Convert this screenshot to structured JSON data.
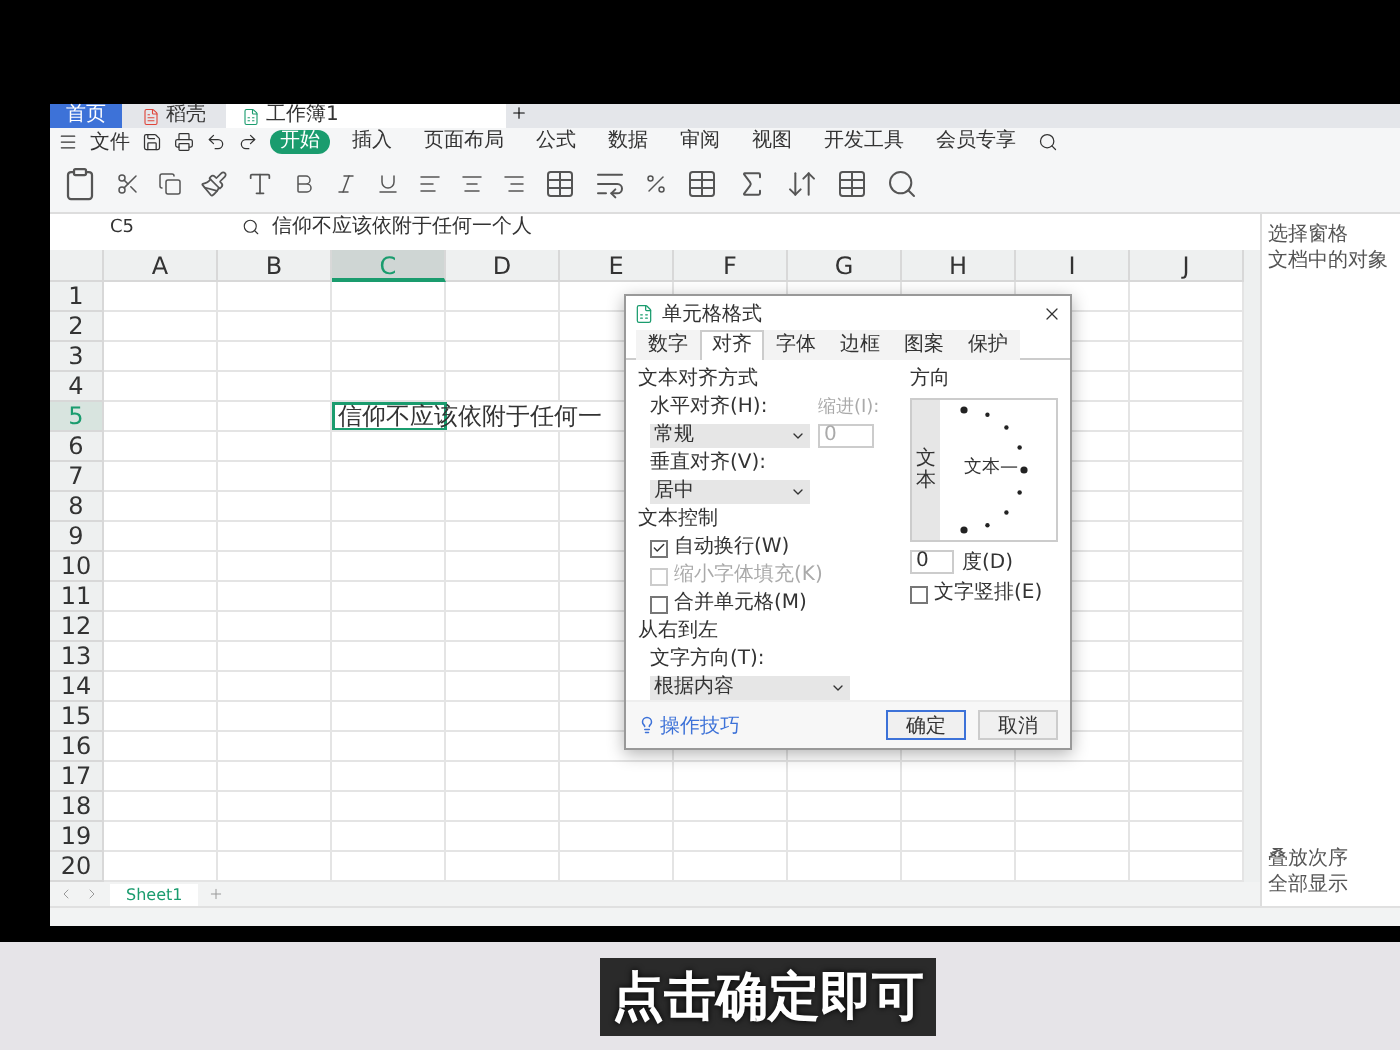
{
  "tabs": [
    {
      "label": "首页",
      "kind": "home",
      "selected": false
    },
    {
      "label": "稻壳",
      "kind": "docer",
      "selected": false
    },
    {
      "label": "工作簿1",
      "kind": "book",
      "selected": true
    }
  ],
  "menu": {
    "file": "文件",
    "items": [
      {
        "label": "开始",
        "selected": true
      },
      {
        "label": "插入",
        "selected": false
      },
      {
        "label": "页面布局",
        "selected": false
      },
      {
        "label": "公式",
        "selected": false
      },
      {
        "label": "数据",
        "selected": false
      },
      {
        "label": "审阅",
        "selected": false
      },
      {
        "label": "视图",
        "selected": false
      },
      {
        "label": "开发工具",
        "selected": false
      },
      {
        "label": "会员专享",
        "selected": false
      }
    ]
  },
  "formula_bar": {
    "name_box": "C5",
    "formula": "信仰不应该依附于任何一个人"
  },
  "sheet": {
    "columns": [
      {
        "label": "A",
        "selected": false
      },
      {
        "label": "B",
        "selected": false
      },
      {
        "label": "C",
        "selected": true
      },
      {
        "label": "D",
        "selected": false
      },
      {
        "label": "E",
        "selected": false
      },
      {
        "label": "F",
        "selected": false
      },
      {
        "label": "G",
        "selected": false
      },
      {
        "label": "H",
        "selected": false
      },
      {
        "label": "I",
        "selected": false
      },
      {
        "label": "J",
        "selected": false
      }
    ],
    "rows": [
      {
        "label": "1",
        "selected": false
      },
      {
        "label": "2",
        "selected": false
      },
      {
        "label": "3",
        "selected": false
      },
      {
        "label": "4",
        "selected": false
      },
      {
        "label": "5",
        "selected": true
      },
      {
        "label": "6",
        "selected": false
      },
      {
        "label": "7",
        "selected": false
      },
      {
        "label": "8",
        "selected": false
      },
      {
        "label": "9",
        "selected": false
      },
      {
        "label": "10",
        "selected": false
      },
      {
        "label": "11",
        "selected": false
      },
      {
        "label": "12",
        "selected": false
      },
      {
        "label": "13",
        "selected": false
      },
      {
        "label": "14",
        "selected": false
      },
      {
        "label": "15",
        "selected": false
      },
      {
        "label": "16",
        "selected": false
      },
      {
        "label": "17",
        "selected": false
      },
      {
        "label": "18",
        "selected": false
      },
      {
        "label": "19",
        "selected": false
      },
      {
        "label": "20",
        "selected": false
      }
    ],
    "active_cell_text": "信仰不应该依附于任何一"
  },
  "sheet_tabs": [
    {
      "label": "Sheet1",
      "selected": true
    }
  ],
  "side_pane": {
    "title": "选择窗格",
    "subtitle": "文档中的对象",
    "footer": [
      "叠放次序",
      "全部显示"
    ]
  },
  "dialog": {
    "title": "单元格格式",
    "tabs": [
      {
        "label": "数字",
        "selected": false
      },
      {
        "label": "对齐",
        "selected": true
      },
      {
        "label": "字体",
        "selected": false
      },
      {
        "label": "边框",
        "selected": false
      },
      {
        "label": "图案",
        "selected": false
      },
      {
        "label": "保护",
        "selected": false
      }
    ],
    "alignment": {
      "heading": "文本对齐方式",
      "horizontal_label": "水平对齐(H):",
      "horizontal_value": "常规",
      "indent_label": "缩进(I):",
      "indent_value": "0",
      "indent_disabled": true,
      "vertical_label": "垂直对齐(V):",
      "vertical_value": "居中"
    },
    "text_control": {
      "heading": "文本控制",
      "options": [
        {
          "label": "自动换行(W)",
          "checked": true,
          "disabled": false
        },
        {
          "label": "缩小字体填充(K)",
          "checked": false,
          "disabled": true
        },
        {
          "label": "合并单元格(M)",
          "checked": false,
          "disabled": false
        }
      ]
    },
    "rtl": {
      "heading": "从右到左",
      "direction_label": "文字方向(T):",
      "direction_value": "根据内容"
    },
    "orientation": {
      "heading": "方向",
      "vertical_text": "文本",
      "dial_text": "文本—",
      "degrees_value": "0",
      "degrees_label": "度(D)",
      "vertical_checkbox": {
        "label": "文字竖排(E)",
        "checked": false
      }
    },
    "tips": "操作技巧",
    "buttons": [
      {
        "label": "确定",
        "kind": "primary"
      },
      {
        "label": "取消",
        "kind": "secondary"
      }
    ]
  },
  "subtitle": "点击确定即可"
}
